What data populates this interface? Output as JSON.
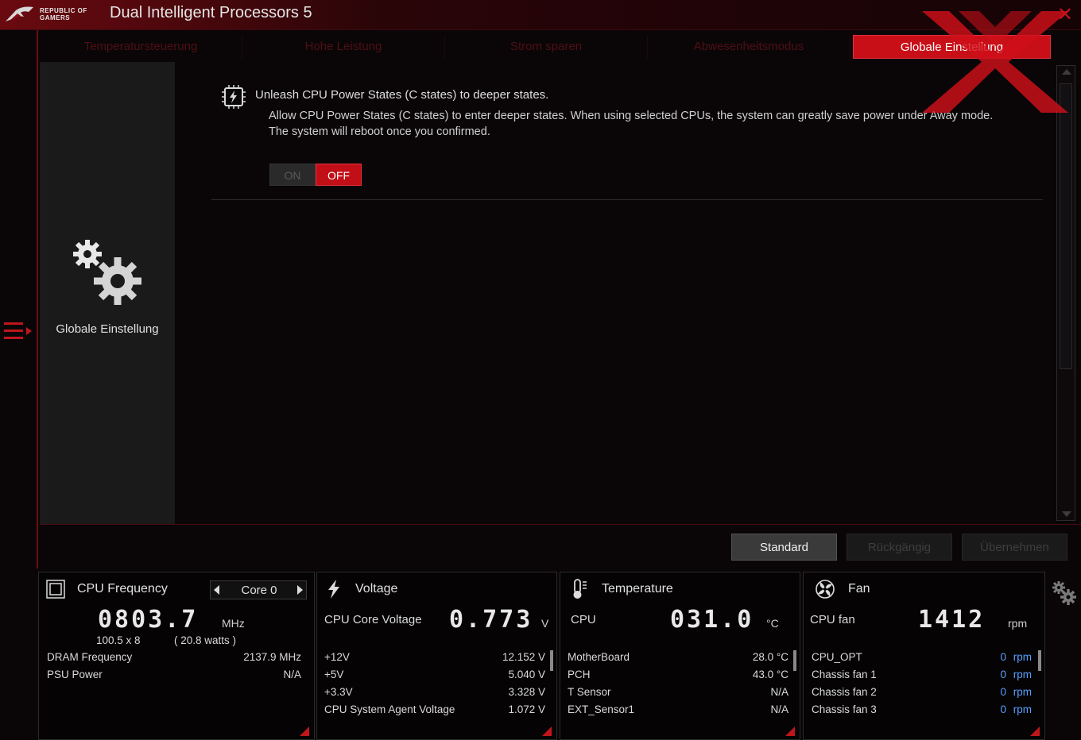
{
  "app": {
    "logo_text": "REPUBLIC OF\nGAMERS",
    "title": "Dual Intelligent Processors 5",
    "close": "✕"
  },
  "tabs": [
    {
      "label": "Temperatursteuerung",
      "active": false
    },
    {
      "label": "Hohe Leistung",
      "active": false
    },
    {
      "label": "Strom sparen",
      "active": false
    },
    {
      "label": "Abwesenheitsmodus",
      "active": false
    },
    {
      "label": "Globale Einstellung",
      "active": true
    }
  ],
  "side": {
    "label": "Globale Einstellung",
    "icon": "gears-icon"
  },
  "setting": {
    "title": "Unleash CPU Power States (C states) to deeper states.",
    "description": "Allow CPU Power States (C states) to enter deeper states. When using selected CPUs, the system can greatly save power under Away mode. The system will reboot once you confirmed.",
    "on_label": "ON",
    "off_label": "OFF",
    "selected": "OFF"
  },
  "buttons": {
    "standard": "Standard",
    "undo": "Rückgängig",
    "apply": "Übernehmen"
  },
  "monitor": {
    "cpu": {
      "title": "CPU Frequency",
      "core_selector": "Core 0",
      "big_value": "0803.7",
      "big_unit": "MHz",
      "ratio_line": "100.5   x   8",
      "watts_line": "( 20.8 watts )",
      "rows": [
        {
          "label": "DRAM Frequency",
          "value": "2137.9  MHz"
        },
        {
          "label": "PSU Power",
          "value": "N/A"
        }
      ]
    },
    "voltage": {
      "title": "Voltage",
      "main_label": "CPU Core Voltage",
      "big_value": "0.773",
      "big_unit": "V",
      "rows": [
        {
          "label": "+12V",
          "value": "12.152  V"
        },
        {
          "label": "+5V",
          "value": "5.040  V"
        },
        {
          "label": "+3.3V",
          "value": "3.328  V"
        },
        {
          "label": "CPU System Agent Voltage",
          "value": "1.072  V"
        }
      ]
    },
    "temperature": {
      "title": "Temperature",
      "main_label": "CPU",
      "big_value": "031.0",
      "big_unit": "°C",
      "rows": [
        {
          "label": "MotherBoard",
          "value": "28.0 °C"
        },
        {
          "label": "PCH",
          "value": "43.0 °C"
        },
        {
          "label": "T Sensor",
          "value": "N/A"
        },
        {
          "label": "EXT_Sensor1",
          "value": "N/A"
        }
      ]
    },
    "fan": {
      "title": "Fan",
      "main_label": "CPU fan",
      "big_value": "1412",
      "big_unit": "rpm",
      "rows": [
        {
          "label": "CPU_OPT",
          "value": "0",
          "unit": "rpm"
        },
        {
          "label": "Chassis fan 1",
          "value": "0",
          "unit": "rpm"
        },
        {
          "label": "Chassis fan 2",
          "value": "0",
          "unit": "rpm"
        },
        {
          "label": "Chassis fan 3",
          "value": "0",
          "unit": "rpm"
        }
      ]
    }
  },
  "colors": {
    "accent": "#c80f17",
    "background": "#0a0608",
    "panel": "#1a1a1a"
  }
}
